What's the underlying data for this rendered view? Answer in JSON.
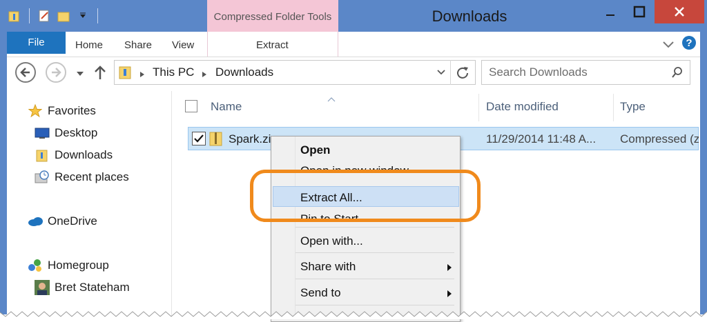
{
  "window": {
    "title": "Downloads",
    "context_tab_group": "Compressed Folder Tools"
  },
  "ribbon": {
    "tabs": [
      "File",
      "Home",
      "Share",
      "View",
      "Extract"
    ]
  },
  "address": {
    "path": [
      "This PC",
      "Downloads"
    ],
    "search_placeholder": "Search Downloads"
  },
  "nav": {
    "favorites": "Favorites",
    "items": [
      "Desktop",
      "Downloads",
      "Recent places"
    ],
    "onedrive": "OneDrive",
    "homegroup": "Homegroup",
    "user": "Bret Stateham"
  },
  "columns": {
    "name": "Name",
    "date": "Date modified",
    "type": "Type"
  },
  "file": {
    "name": "Spark.zi",
    "date": "11/29/2014 11:48 A...",
    "type": "Compressed (z"
  },
  "menu": {
    "open": "Open",
    "open_new_window": "Open in new window",
    "extract_all": "Extract All...",
    "pin_to_start": "Pin to Start",
    "open_with": "Open with...",
    "share_with": "Share with",
    "send_to": "Send to"
  },
  "colors": {
    "titlebar": "#5b87c8",
    "file_tab": "#1e73be",
    "context_tools": "#f4c6d6",
    "highlight": "#f08a1c",
    "selection": "#cce4f7"
  }
}
